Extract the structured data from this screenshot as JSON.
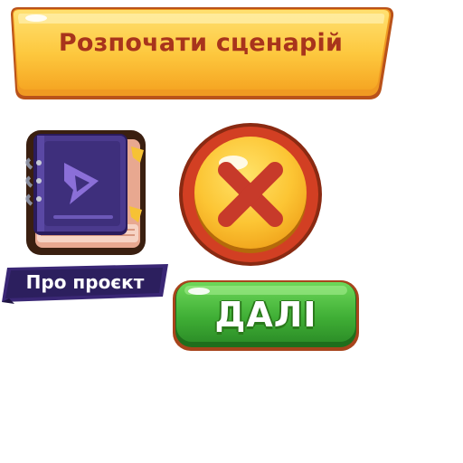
{
  "start_scenario": {
    "label": "Розпочати сценарій"
  },
  "about_project": {
    "label": "Про проєкт",
    "icon": "book-icon"
  },
  "close": {
    "icon": "close-icon"
  },
  "next": {
    "label": "ДАЛІ"
  },
  "colors": {
    "banner_yellow": "#fcc63a",
    "banner_text": "#a8341c",
    "close_red": "#c0392b",
    "next_green": "#45b43a",
    "ribbon_purple": "#3d2a78",
    "book_purple": "#4a3a8c"
  }
}
